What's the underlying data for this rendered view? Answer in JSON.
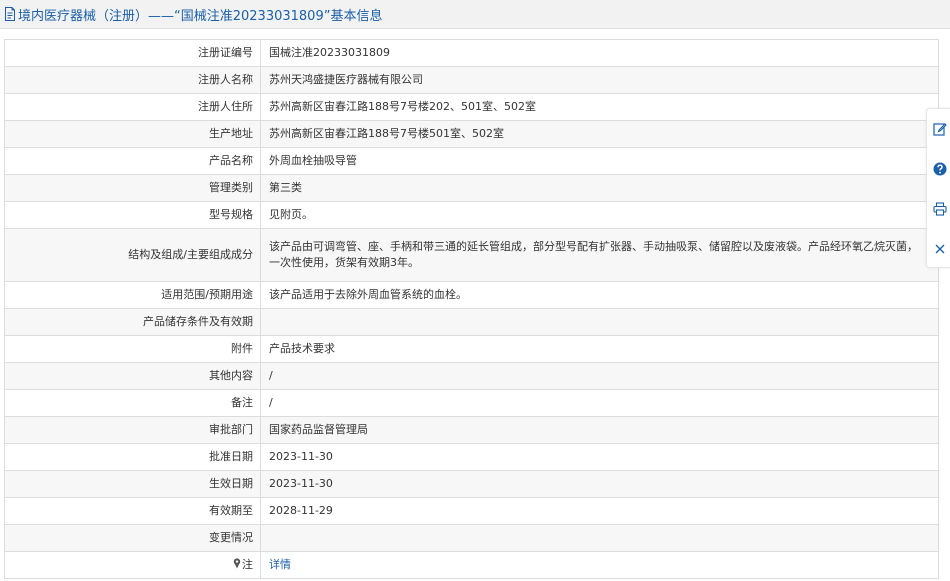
{
  "header": {
    "title": "境内医疗器械（注册）——“国械注准20233031809”基本信息"
  },
  "rows": [
    {
      "label": "注册证编号",
      "value": "国械注准20233031809"
    },
    {
      "label": "注册人名称",
      "value": "苏州天鸿盛捷医疗器械有限公司"
    },
    {
      "label": "注册人住所",
      "value": "苏州高新区宙春江路188号7号楼202、501室、502室"
    },
    {
      "label": "生产地址",
      "value": "苏州高新区宙春江路188号7号楼501室、502室"
    },
    {
      "label": "产品名称",
      "value": "外周血栓抽吸导管"
    },
    {
      "label": "管理类别",
      "value": "第三类"
    },
    {
      "label": "型号规格",
      "value": "见附页。"
    },
    {
      "label": "结构及组成/主要组成成分",
      "value": "该产品由可调弯管、座、手柄和带三通的延长管组成，部分型号配有扩张器、手动抽吸泵、储留腔以及废液袋。产品经环氧乙烷灭菌，一次性使用，货架有效期3年。"
    },
    {
      "label": "适用范围/预期用途",
      "value": "该产品适用于去除外周血管系统的血栓。"
    },
    {
      "label": "产品储存条件及有效期",
      "value": ""
    },
    {
      "label": "附件",
      "value": "产品技术要求"
    },
    {
      "label": "其他内容",
      "value": "/"
    },
    {
      "label": "备注",
      "value": "/"
    },
    {
      "label": "审批部门",
      "value": "国家药品监督管理局"
    },
    {
      "label": "批准日期",
      "value": "2023-11-30"
    },
    {
      "label": "生效日期",
      "value": "2023-11-30"
    },
    {
      "label": "有效期至",
      "value": "2028-11-29"
    },
    {
      "label": "变更情况",
      "value": ""
    }
  ],
  "note_row": {
    "label": "注",
    "link": "详情"
  },
  "colors": {
    "accent": "#1a5fa8",
    "header_bg": "#f2f2f2",
    "border": "#dcdcdc",
    "help_icon": "#1a5fa8"
  },
  "sidebar_icons": [
    "edit-icon",
    "help-icon",
    "print-icon",
    "close-icon"
  ]
}
